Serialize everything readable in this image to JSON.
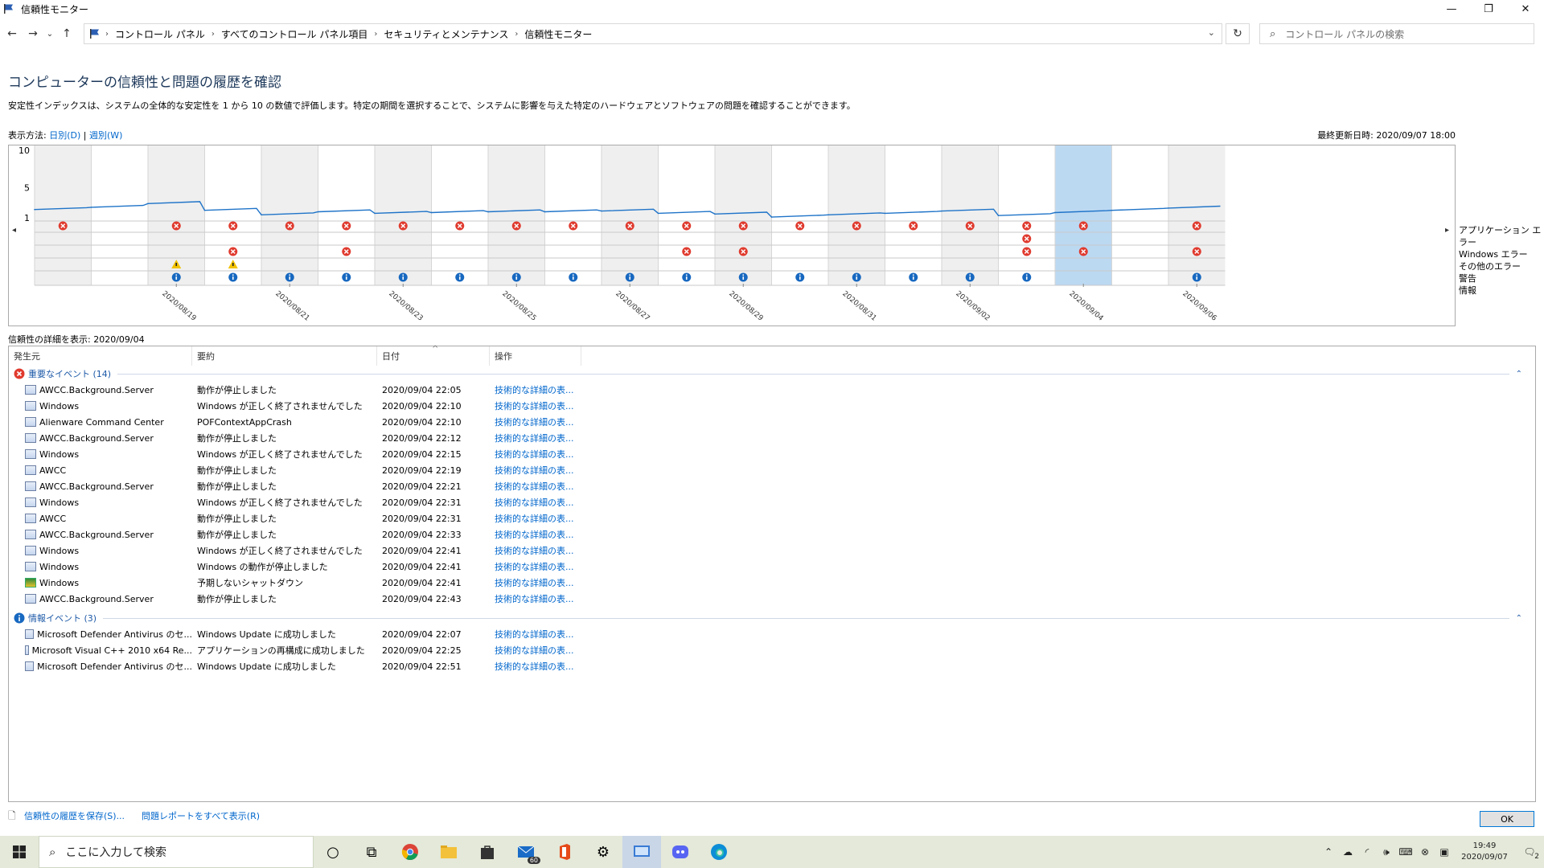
{
  "window": {
    "title": "信頼性モニター",
    "minimize": "—",
    "maximize": "❐",
    "close": "✕"
  },
  "nav": {
    "back": "←",
    "forward": "→",
    "recent": "⌄",
    "up": "↑",
    "breadcrumbs": [
      "コントロール パネル",
      "すべてのコントロール パネル項目",
      "セキュリティとメンテナンス",
      "信頼性モニター"
    ],
    "refresh": "↻",
    "search_placeholder": "コントロール パネルの検索"
  },
  "page": {
    "title": "コンピューターの信頼性と問題の履歴を確認",
    "description": "安定性インデックスは、システムの全体的な安定性を 1 から 10 の数値で評価します。特定の期間を選択することで、システムに影響を与えた特定のハードウェアとソフトウェアの問題を確認することができます。",
    "view_label": "表示方法:",
    "view_daily": "日別(D)",
    "view_sep": "|",
    "view_weekly": "週別(W)",
    "last_updated": "最終更新日時: 2020/09/07 18:00",
    "detail_header": "信頼性の詳細を表示: 2020/09/04"
  },
  "chart_data": {
    "type": "line",
    "title": "",
    "y_ticks": [
      "10",
      "5",
      "1"
    ],
    "ylim": [
      1,
      10
    ],
    "dates": [
      "2020/08/18",
      "2020/08/19",
      "2020/08/20",
      "2020/08/21",
      "2020/08/22",
      "2020/08/23",
      "2020/08/24",
      "2020/08/25",
      "2020/08/26",
      "2020/08/27",
      "2020/08/28",
      "2020/08/29",
      "2020/08/30",
      "2020/08/31",
      "2020/09/01",
      "2020/09/02",
      "2020/09/03",
      "2020/09/04",
      "2020/09/05",
      "2020/09/06"
    ],
    "x_labels": [
      "2020/08/19",
      "2020/08/21",
      "2020/08/23",
      "2020/08/25",
      "2020/08/27",
      "2020/08/29",
      "2020/08/31",
      "2020/09/02",
      "2020/09/04",
      "2020/09/06"
    ],
    "selected_date": "2020/09/04",
    "stability_index": [
      2.1,
      2.4,
      2.9,
      2.0,
      1.4,
      1.8,
      1.6,
      1.7,
      1.8,
      1.8,
      1.9,
      1.6,
      1.5,
      1.1,
      1.4,
      1.6,
      1.9,
      1.3,
      1.7,
      2.0,
      2.3
    ],
    "rows": [
      "アプリケーション エラー",
      "Windows エラー",
      "その他のエラー",
      "警告",
      "情報"
    ],
    "app_errors": [
      1,
      0,
      1,
      1,
      1,
      1,
      1,
      1,
      1,
      1,
      1,
      1,
      1,
      1,
      1,
      1,
      1,
      1,
      1,
      0,
      1
    ],
    "windows_errors": [
      0,
      0,
      0,
      0,
      0,
      0,
      0,
      0,
      0,
      0,
      0,
      0,
      0,
      0,
      0,
      0,
      0,
      1,
      0,
      0,
      0
    ],
    "other_errors": [
      0,
      0,
      0,
      1,
      0,
      1,
      0,
      0,
      0,
      0,
      0,
      1,
      1,
      0,
      0,
      0,
      0,
      1,
      1,
      0,
      1
    ],
    "warnings": [
      0,
      0,
      1,
      1,
      0,
      0,
      0,
      0,
      0,
      0,
      0,
      0,
      0,
      0,
      0,
      0,
      0,
      0,
      0,
      0,
      0
    ],
    "information": [
      0,
      0,
      1,
      1,
      1,
      1,
      1,
      1,
      1,
      1,
      1,
      1,
      1,
      1,
      1,
      1,
      1,
      1,
      0,
      0,
      1
    ],
    "line_color": "#1e73c8",
    "selected_color": "#bcd9f2",
    "error_color": "#e03a2e",
    "warning_color": "#f2c200",
    "info_color": "#1768c0"
  },
  "table": {
    "columns": [
      "発生元",
      "要約",
      "日付",
      "操作"
    ],
    "sort_indicator": "^",
    "critical_group": "重要なイベント (14)",
    "critical_rows": [
      {
        "source": "AWCC.Background.Server",
        "summary": "動作が停止しました",
        "date": "2020/09/04 22:05",
        "action": "技術的な詳細の表..."
      },
      {
        "source": "Windows",
        "summary": "Windows が正しく終了されませんでした",
        "date": "2020/09/04 22:10",
        "action": "技術的な詳細の表..."
      },
      {
        "source": "Alienware Command Center",
        "summary": "POFContextAppCrash",
        "date": "2020/09/04 22:10",
        "action": "技術的な詳細の表..."
      },
      {
        "source": "AWCC.Background.Server",
        "summary": "動作が停止しました",
        "date": "2020/09/04 22:12",
        "action": "技術的な詳細の表..."
      },
      {
        "source": "Windows",
        "summary": "Windows が正しく終了されませんでした",
        "date": "2020/09/04 22:15",
        "action": "技術的な詳細の表..."
      },
      {
        "source": "AWCC",
        "summary": "動作が停止しました",
        "date": "2020/09/04 22:19",
        "action": "技術的な詳細の表..."
      },
      {
        "source": "AWCC.Background.Server",
        "summary": "動作が停止しました",
        "date": "2020/09/04 22:21",
        "action": "技術的な詳細の表..."
      },
      {
        "source": "Windows",
        "summary": "Windows が正しく終了されませんでした",
        "date": "2020/09/04 22:31",
        "action": "技術的な詳細の表..."
      },
      {
        "source": "AWCC",
        "summary": "動作が停止しました",
        "date": "2020/09/04 22:31",
        "action": "技術的な詳細の表..."
      },
      {
        "source": "AWCC.Background.Server",
        "summary": "動作が停止しました",
        "date": "2020/09/04 22:33",
        "action": "技術的な詳細の表..."
      },
      {
        "source": "Windows",
        "summary": "Windows が正しく終了されませんでした",
        "date": "2020/09/04 22:41",
        "action": "技術的な詳細の表..."
      },
      {
        "source": "Windows",
        "summary": "Windows の動作が停止しました",
        "date": "2020/09/04 22:41",
        "action": "技術的な詳細の表..."
      },
      {
        "source": "Windows",
        "summary": "予期しないシャットダウン",
        "date": "2020/09/04 22:41",
        "action": "技術的な詳細の表...",
        "icon": "shield"
      },
      {
        "source": "AWCC.Background.Server",
        "summary": "動作が停止しました",
        "date": "2020/09/04 22:43",
        "action": "技術的な詳細の表..."
      }
    ],
    "info_group": "情報イベント (3)",
    "info_rows": [
      {
        "source": "Microsoft Defender Antivirus のセ...",
        "summary": "Windows Update に成功しました",
        "date": "2020/09/04 22:07",
        "action": "技術的な詳細の表..."
      },
      {
        "source": "Microsoft Visual C++ 2010  x64 Re...",
        "summary": "アプリケーションの再構成に成功しました",
        "date": "2020/09/04 22:25",
        "action": "技術的な詳細の表..."
      },
      {
        "source": "Microsoft Defender Antivirus のセ...",
        "summary": "Windows Update に成功しました",
        "date": "2020/09/04 22:51",
        "action": "技術的な詳細の表..."
      }
    ]
  },
  "footer": {
    "save_history": "信頼性の履歴を保存(S)...",
    "view_all_reports": "問題レポートをすべて表示(R)",
    "ok": "OK"
  },
  "taskbar": {
    "search_placeholder": "ここに入力して検索",
    "mail_badge": "60",
    "time": "19:49",
    "date": "2020/09/07",
    "notif_count": "2"
  }
}
